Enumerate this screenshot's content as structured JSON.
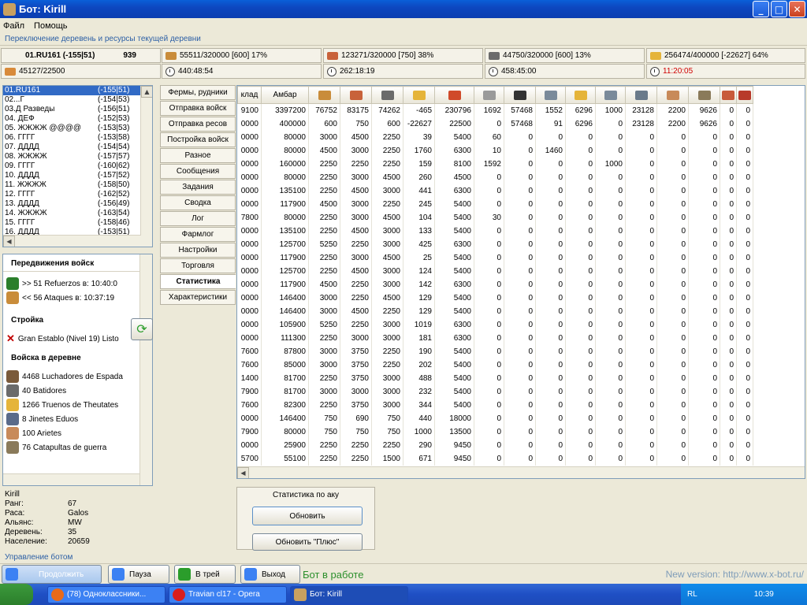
{
  "window": {
    "title": "Бот: Kirill"
  },
  "menu": [
    "Файл",
    "Помощь"
  ],
  "sections": {
    "top": "Переключение деревень и ресурсы текущей деревни",
    "bottom": "Управление ботом"
  },
  "village_header": {
    "name": "01.RU161 (-155|51)",
    "population": "939"
  },
  "resources": [
    {
      "icon": "wood-icon",
      "value": "55511/320000 [600]  17%"
    },
    {
      "icon": "clay-icon",
      "value": "123271/320000 [750]  38%"
    },
    {
      "icon": "iron-icon",
      "value": "44750/320000 [600]  13%"
    },
    {
      "icon": "crop-icon",
      "value": "256474/400000 [-22627]  64%"
    }
  ],
  "resources_row2": [
    {
      "icon": "attack-icon",
      "value": "45127/22500"
    },
    {
      "icon": "clock-icon",
      "value": "440:48:54"
    },
    {
      "icon": "clock-icon",
      "value": "262:18:19"
    },
    {
      "icon": "clock-icon",
      "value": "458:45:00"
    },
    {
      "icon": "clock-icon",
      "value": "11:20:05",
      "color": "#d00000"
    }
  ],
  "villages": [
    {
      "name": "01.RU161",
      "coords": "(-155|51)",
      "selected": true
    },
    {
      "name": "02...Г",
      "coords": "(-154|53)"
    },
    {
      "name": "03.Д Разведы",
      "coords": "(-156|51)"
    },
    {
      "name": "04. ДЕФ",
      "coords": "(-152|53)"
    },
    {
      "name": "05. ЖЖЖЖ @@@@",
      "coords": "(-153|53)"
    },
    {
      "name": "06. ГГГГ",
      "coords": "(-153|58)"
    },
    {
      "name": "07. ДДДД",
      "coords": "(-154|54)"
    },
    {
      "name": "08. ЖЖЖЖ",
      "coords": "(-157|57)"
    },
    {
      "name": "09. ГГГГ",
      "coords": "(-160|62)"
    },
    {
      "name": "10. ДДДД",
      "coords": "(-157|52)"
    },
    {
      "name": "11. ЖЖЖЖ",
      "coords": "(-158|50)"
    },
    {
      "name": "12. ГГГГ",
      "coords": "(-162|52)"
    },
    {
      "name": "13. ДДДД",
      "coords": "(-156|49)"
    },
    {
      "name": "14. ЖЖЖЖ",
      "coords": "(-163|54)"
    },
    {
      "name": "15. ГГГГ",
      "coords": "(-158|46)"
    },
    {
      "name": "16. ДДДД",
      "coords": "(-153|51)"
    }
  ],
  "movements": {
    "title": "Передвижения войск",
    "items": [
      {
        "icon": "reinforcement-icon",
        "text": ">> 51   Refuerzos в: 10:40:0"
      },
      {
        "icon": "attack-icon",
        "text": "<< 56   Ataques в: 10:37:19"
      }
    ]
  },
  "construction": {
    "title": "Стройка",
    "items": [
      {
        "icon": "cross-icon",
        "text": "Gran Establo (Nivel 19) Listo"
      }
    ]
  },
  "troops": {
    "title": "Войска в деревне",
    "items": [
      {
        "icon": "swordsman-icon",
        "text": "4468 Luchadores de Espada"
      },
      {
        "icon": "pathfinder-icon",
        "text": "40 Batidores"
      },
      {
        "icon": "thunder-icon",
        "text": "1266 Truenos de Theutates"
      },
      {
        "icon": "druid-icon",
        "text": "8 Jinetes Eduos"
      },
      {
        "icon": "ram-icon",
        "text": "100 Arietes"
      },
      {
        "icon": "catapult-icon",
        "text": "76 Catapultas de guerra"
      }
    ]
  },
  "player": [
    {
      "k": "Kirill",
      "v": ""
    },
    {
      "k": "Ранг:",
      "v": "67"
    },
    {
      "k": "Раса:",
      "v": "Galos"
    },
    {
      "k": "Альянс:",
      "v": "MW"
    },
    {
      "k": "Деревень:",
      "v": "35"
    },
    {
      "k": "Население:",
      "v": "20659"
    }
  ],
  "tabs": [
    {
      "label": "Фермы, рудники"
    },
    {
      "label": "Отправка войск"
    },
    {
      "label": "Отправка ресов"
    },
    {
      "label": "Постройка войск"
    },
    {
      "label": "Разное"
    },
    {
      "label": "Сообщения"
    },
    {
      "label": "Задания"
    },
    {
      "label": "Сводка"
    },
    {
      "label": "Лог"
    },
    {
      "label": "Фармлог"
    },
    {
      "label": "Настройки"
    },
    {
      "label": "Торговля"
    },
    {
      "label": "Статистика",
      "active": true
    },
    {
      "label": "Характеристики"
    }
  ],
  "table": {
    "headers": [
      "клад",
      "Амбар",
      "wood-icon",
      "clay-icon",
      "iron-icon",
      "crop-icon",
      "cross-icon",
      "club-icon",
      "spear-icon",
      "horse-icon",
      "thunder-icon",
      "horse2-icon",
      "horse3-icon",
      "ram-icon",
      "catapult-icon",
      "chief-icon",
      "settler-icon"
    ],
    "rows": [
      [
        "9100",
        "3397200",
        "76752",
        "83175",
        "74262",
        "-465",
        "230796",
        "1692",
        "57468",
        "1552",
        "6296",
        "1000",
        "23128",
        "2200",
        "9626",
        "0",
        "0"
      ],
      [
        "0000",
        "400000",
        "600",
        "750",
        "600",
        "-22627",
        "22500",
        "0",
        "57468",
        "91",
        "6296",
        "0",
        "23128",
        "2200",
        "9626",
        "0",
        "0"
      ],
      [
        "0000",
        "80000",
        "3000",
        "4500",
        "2250",
        "39",
        "5400",
        "60",
        "0",
        "0",
        "0",
        "0",
        "0",
        "0",
        "0",
        "0",
        "0"
      ],
      [
        "0000",
        "80000",
        "4500",
        "3000",
        "2250",
        "1760",
        "6300",
        "10",
        "0",
        "1460",
        "0",
        "0",
        "0",
        "0",
        "0",
        "0",
        "0"
      ],
      [
        "0000",
        "160000",
        "2250",
        "2250",
        "2250",
        "159",
        "8100",
        "1592",
        "0",
        "0",
        "0",
        "1000",
        "0",
        "0",
        "0",
        "0",
        "0"
      ],
      [
        "0000",
        "80000",
        "2250",
        "3000",
        "4500",
        "260",
        "4500",
        "0",
        "0",
        "0",
        "0",
        "0",
        "0",
        "0",
        "0",
        "0",
        "0"
      ],
      [
        "0000",
        "135100",
        "2250",
        "4500",
        "3000",
        "441",
        "6300",
        "0",
        "0",
        "0",
        "0",
        "0",
        "0",
        "0",
        "0",
        "0",
        "0"
      ],
      [
        "0000",
        "117900",
        "4500",
        "3000",
        "2250",
        "245",
        "5400",
        "0",
        "0",
        "0",
        "0",
        "0",
        "0",
        "0",
        "0",
        "0",
        "0"
      ],
      [
        "7800",
        "80000",
        "2250",
        "3000",
        "4500",
        "104",
        "5400",
        "30",
        "0",
        "0",
        "0",
        "0",
        "0",
        "0",
        "0",
        "0",
        "0"
      ],
      [
        "0000",
        "135100",
        "2250",
        "4500",
        "3000",
        "133",
        "5400",
        "0",
        "0",
        "0",
        "0",
        "0",
        "0",
        "0",
        "0",
        "0",
        "0"
      ],
      [
        "0000",
        "125700",
        "5250",
        "2250",
        "3000",
        "425",
        "6300",
        "0",
        "0",
        "0",
        "0",
        "0",
        "0",
        "0",
        "0",
        "0",
        "0"
      ],
      [
        "0000",
        "117900",
        "2250",
        "3000",
        "4500",
        "25",
        "5400",
        "0",
        "0",
        "0",
        "0",
        "0",
        "0",
        "0",
        "0",
        "0",
        "0"
      ],
      [
        "0000",
        "125700",
        "2250",
        "4500",
        "3000",
        "124",
        "5400",
        "0",
        "0",
        "0",
        "0",
        "0",
        "0",
        "0",
        "0",
        "0",
        "0"
      ],
      [
        "0000",
        "117900",
        "4500",
        "2250",
        "3000",
        "142",
        "6300",
        "0",
        "0",
        "0",
        "0",
        "0",
        "0",
        "0",
        "0",
        "0",
        "0"
      ],
      [
        "0000",
        "146400",
        "3000",
        "2250",
        "4500",
        "129",
        "5400",
        "0",
        "0",
        "0",
        "0",
        "0",
        "0",
        "0",
        "0",
        "0",
        "0"
      ],
      [
        "0000",
        "146400",
        "3000",
        "4500",
        "2250",
        "129",
        "5400",
        "0",
        "0",
        "0",
        "0",
        "0",
        "0",
        "0",
        "0",
        "0",
        "0"
      ],
      [
        "0000",
        "105900",
        "5250",
        "2250",
        "3000",
        "1019",
        "6300",
        "0",
        "0",
        "0",
        "0",
        "0",
        "0",
        "0",
        "0",
        "0",
        "0"
      ],
      [
        "0000",
        "111300",
        "2250",
        "3000",
        "3000",
        "181",
        "6300",
        "0",
        "0",
        "0",
        "0",
        "0",
        "0",
        "0",
        "0",
        "0",
        "0"
      ],
      [
        "7600",
        "87800",
        "3000",
        "3750",
        "2250",
        "190",
        "5400",
        "0",
        "0",
        "0",
        "0",
        "0",
        "0",
        "0",
        "0",
        "0",
        "0"
      ],
      [
        "7600",
        "85000",
        "3000",
        "3750",
        "2250",
        "202",
        "5400",
        "0",
        "0",
        "0",
        "0",
        "0",
        "0",
        "0",
        "0",
        "0",
        "0"
      ],
      [
        "1400",
        "81700",
        "2250",
        "3750",
        "3000",
        "488",
        "5400",
        "0",
        "0",
        "0",
        "0",
        "0",
        "0",
        "0",
        "0",
        "0",
        "0"
      ],
      [
        "7900",
        "81700",
        "3000",
        "3000",
        "3000",
        "232",
        "5400",
        "0",
        "0",
        "0",
        "0",
        "0",
        "0",
        "0",
        "0",
        "0",
        "0"
      ],
      [
        "7600",
        "82300",
        "2250",
        "3750",
        "3000",
        "344",
        "5400",
        "0",
        "0",
        "0",
        "0",
        "0",
        "0",
        "0",
        "0",
        "0",
        "0"
      ],
      [
        "0000",
        "146400",
        "750",
        "690",
        "750",
        "440",
        "18000",
        "0",
        "0",
        "0",
        "0",
        "0",
        "0",
        "0",
        "0",
        "0",
        "0"
      ],
      [
        "7900",
        "80000",
        "750",
        "750",
        "750",
        "1000",
        "13500",
        "0",
        "0",
        "0",
        "0",
        "0",
        "0",
        "0",
        "0",
        "0",
        "0"
      ],
      [
        "0000",
        "25900",
        "2250",
        "2250",
        "2250",
        "290",
        "9450",
        "0",
        "0",
        "0",
        "0",
        "0",
        "0",
        "0",
        "0",
        "0",
        "0"
      ],
      [
        "5700",
        "55100",
        "2250",
        "2250",
        "1500",
        "671",
        "9450",
        "0",
        "0",
        "0",
        "0",
        "0",
        "0",
        "0",
        "0",
        "0",
        "0"
      ]
    ]
  },
  "stats": {
    "title": "Статистика по аку",
    "refresh": "Обновить",
    "refresh_plus": "Обновить \"Плюс\""
  },
  "controls": {
    "continue": "Продолжить",
    "pause": "Пауза",
    "tray": "В трей",
    "exit": "Выход",
    "status": "Бот в работе",
    "new_version": "New version: http://www.x-bot.ru/"
  },
  "taskbar": {
    "tasks": [
      "(78) Одноклассники...",
      "Travian cl17 - Opera",
      "Бот: Kirill"
    ],
    "lang": "RL",
    "time": "10:39"
  }
}
